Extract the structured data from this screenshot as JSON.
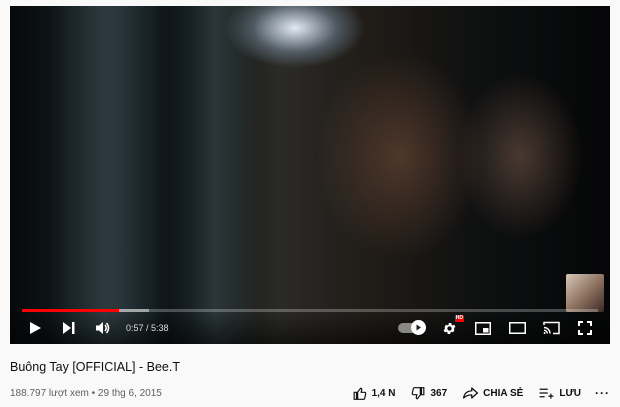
{
  "player": {
    "time_current": "0:57",
    "time_separator": " / ",
    "time_total": "5:38",
    "progress_played_fraction": 0.169,
    "progress_buffered_fraction": 0.22,
    "settings_badge": "HD",
    "accent_color": "#ff0000"
  },
  "video": {
    "title": "Buông Tay [OFFICIAL] - Bee.T",
    "views": "188.797 lượt xem",
    "separator": " • ",
    "date": "29 thg 6, 2015"
  },
  "actions": {
    "like_count": "1,4 N",
    "dislike_count": "367",
    "share_label": "CHIA SẺ",
    "save_label": "LƯU",
    "more_label": "···"
  },
  "icons": [
    "play-icon",
    "next-icon",
    "volume-icon",
    "autoplay-toggle",
    "settings-icon",
    "miniplayer-icon",
    "theater-icon",
    "cast-icon",
    "fullscreen-icon",
    "thumbs-up-icon",
    "thumbs-down-icon",
    "share-icon",
    "playlist-add-icon",
    "more-icon"
  ]
}
